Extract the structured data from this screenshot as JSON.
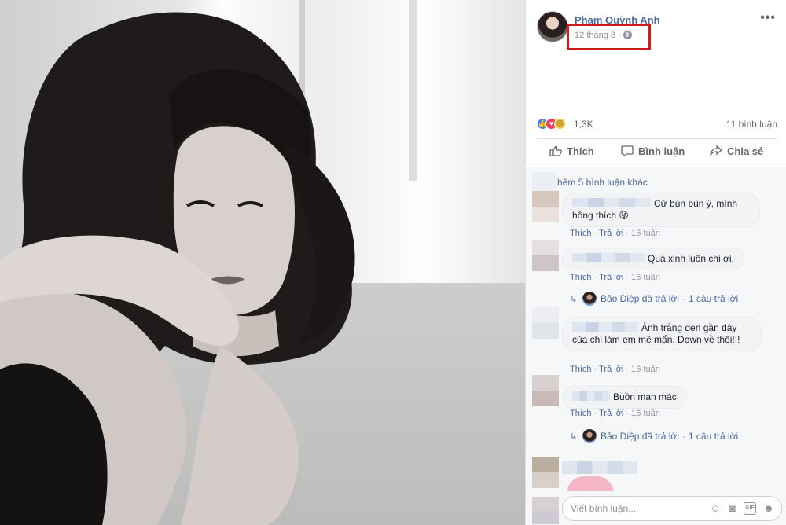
{
  "post": {
    "author": "Phạm Quỳnh Anh",
    "timestamp": "12 tháng 8 ·",
    "privacy_icon": "globe-icon",
    "more_icon": "more-horizontal-icon",
    "more_glyph": "•••"
  },
  "reactions": {
    "icons": [
      "like-icon",
      "love-icon",
      "sad-icon"
    ],
    "count": "1,3K",
    "comments": "11 bình luận"
  },
  "actions": {
    "like": "Thích",
    "comment": "Bình luận",
    "share": "Chia sẻ"
  },
  "comments_section": {
    "view_more": "hêm 5 bình luận khác",
    "comments": [
      {
        "text": "Cứ bủn bủn ý, mình hông thích 😝",
        "time": "16 tuần"
      },
      {
        "text": "Quá xinh luôn chi ơi.",
        "time": "16 tuần",
        "reply": {
          "text": "Bảo Diệp đã trả lời",
          "count": "1 câu trả lời"
        }
      },
      {
        "text": "Ảnh trắng đen gần đây của chi làm em mê mẩn. Down về thôi!!!",
        "time": "16 tuần"
      },
      {
        "text": "Buồn man mác",
        "time": "16 tuần",
        "reply": {
          "text": "Bảo Diệp đã trả lời",
          "count": "1 câu trả lời"
        }
      }
    ],
    "like_label": "Thích",
    "reply_label": "Trả lời",
    "separator": "·"
  },
  "composer": {
    "placeholder": "Viết bình luận...",
    "icons": [
      "emoji-icon",
      "camera-icon",
      "gif-icon",
      "sticker-icon"
    ],
    "gif_label": "GIF"
  }
}
